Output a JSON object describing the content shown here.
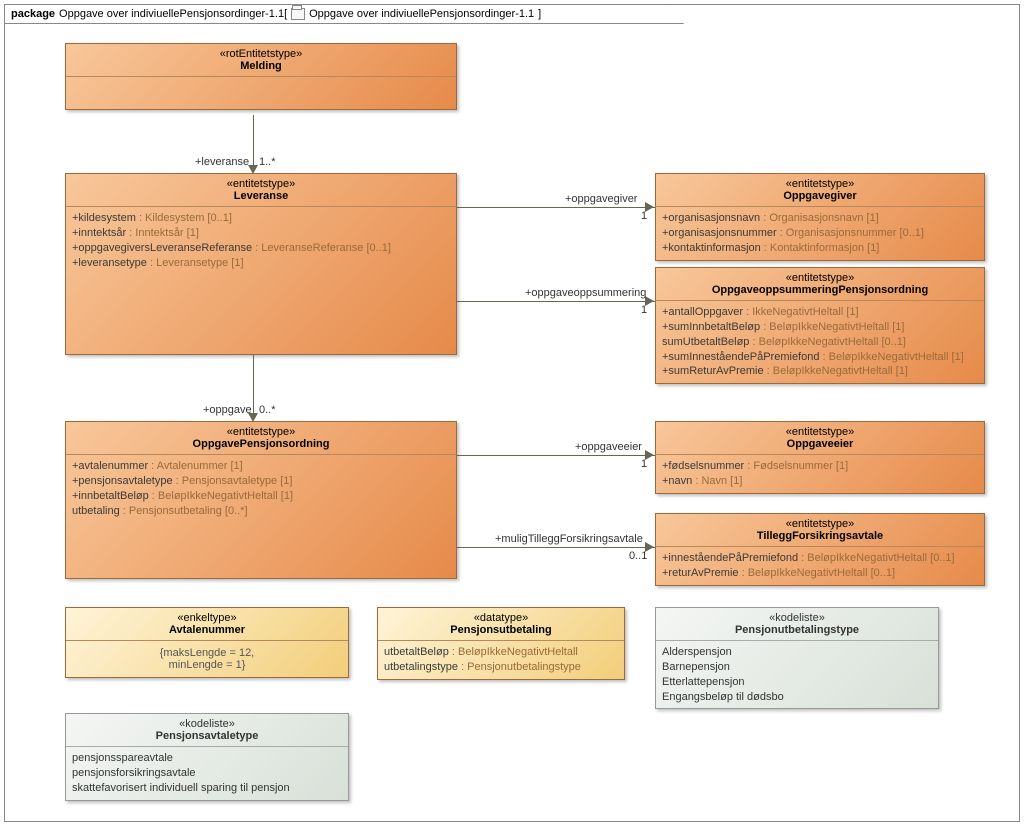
{
  "tab": {
    "kw": "package",
    "name": "Oppgave over indiviuellePensjonsordinger-1.1",
    "inner": "Oppgave over indiviuellePensjonsordinger-1.1"
  },
  "relLabels": {
    "leveranse": "+leveranse",
    "leveranseMult": "1..*",
    "oppgave": "+oppgave",
    "oppgaveMult": "0..*",
    "oppgavegiver": "+oppgavegiver",
    "oppgavegiverMult": "1",
    "oppgaveoppsummering": "+oppgaveoppsummering",
    "oppgaveoppsummeringMult": "1",
    "oppgaveeier": "+oppgaveeier",
    "oppgaveeierMult": "1",
    "tillegg": "+muligTilleggForsikringsavtale",
    "tilleggMult": "0..1"
  },
  "melding": {
    "st": "«rotEntitetstype»",
    "nm": "Melding"
  },
  "leveranse": {
    "st": "«entitetstype»",
    "nm": "Leveranse",
    "a1n": "+kildesystem",
    "a1t": " : Kildesystem [0..1]",
    "a2n": "+inntektsår",
    "a2t": " : Inntektsår [1]",
    "a3n": "+oppgavegiversLeveranseReferanse",
    "a3t": " : LeveranseReferanse [0..1]",
    "a4n": "+leveransetype",
    "a4t": " : Leveransetype [1]"
  },
  "oppgave": {
    "st": "«entitetstype»",
    "nm": "OppgavePensjonsordning",
    "a1n": "+avtalenummer",
    "a1t": " : Avtalenummer [1]",
    "a2n": "+pensjonsavtaletype",
    "a2t": " : Pensjonsavtaletype [1]",
    "a3n": "+innbetaltBeløp",
    "a3t": " : BeløpIkkeNegativtHeltall [1]",
    "a4n": " utbetaling",
    "a4t": " : Pensjonsutbetaling [0..*]"
  },
  "oppgavegiver": {
    "st": "«entitetstype»",
    "nm": "Oppgavegiver",
    "a1n": "+organisasjonsnavn",
    "a1t": " : Organisasjonsnavn [1]",
    "a2n": "+organisasjonsnummer",
    "a2t": " : Organisasjonsnummer [0..1]",
    "a3n": "+kontaktinformasjon",
    "a3t": " : Kontaktinformasjon [1]"
  },
  "oppsum": {
    "st": "«entitetstype»",
    "nm": "OppgaveoppsummeringPensjonsordning",
    "a1n": "+antallOppgaver",
    "a1t": " : IkkeNegativtHeltall [1]",
    "a2n": "+sumInnbetaltBeløp",
    "a2t": " : BeløpIkkeNegativtHeltall [1]",
    "a3n": " sumUtbetaltBeløp",
    "a3t": " : BeløpIkkeNegativtHeltall [0..1]",
    "a4n": "+sumInneståendePåPremiefond",
    "a4t": " : BeløpIkkeNegativtHeltall [1]",
    "a5n": "+sumReturAvPremie",
    "a5t": " : BeløpIkkeNegativtHeltall [1]"
  },
  "oppgaveeier": {
    "st": "«entitetstype»",
    "nm": "Oppgaveeier",
    "a1n": "+fødselsnummer",
    "a1t": " : Fødselsnummer [1]",
    "a2n": "+navn",
    "a2t": " : Navn [1]"
  },
  "tillegg": {
    "st": "«entitetstype»",
    "nm": "TilleggForsikringsavtale",
    "a1n": "+inneståendePåPremiefond",
    "a1t": " : BeløpIkkeNegativtHeltall [0..1]",
    "a2n": "+returAvPremie",
    "a2t": " : BeløpIkkeNegativtHeltall [0..1]"
  },
  "avtalenummer": {
    "st": "«enkeltype»",
    "nm": "Avtalenummer",
    "c": "{maksLengde = 12,\nminLengde = 1}"
  },
  "pensjonsutbetaling": {
    "st": "«datatype»",
    "nm": "Pensjonsutbetaling",
    "a1n": " utbetaltBeløp",
    "a1t": " : BeløpIkkeNegativtHeltall",
    "a2n": " utbetalingstype",
    "a2t": " : Pensjonutbetalingstype"
  },
  "pensjonutbetalingstype": {
    "st": "«kodeliste»",
    "nm": "Pensjonutbetalingstype",
    "v1": " Alderspensjon",
    "v2": " Barnepensjon",
    "v3": " Etterlattepensjon",
    "v4": " Engangsbeløp til dødsbo"
  },
  "pensjonsavtaletype": {
    "st": "«kodeliste»",
    "nm": "Pensjonsavtaletype",
    "v1": " pensjonsspareavtale",
    "v2": " pensjonsforsikringsavtale",
    "v3": " skattefavorisert individuell sparing til pensjon"
  }
}
